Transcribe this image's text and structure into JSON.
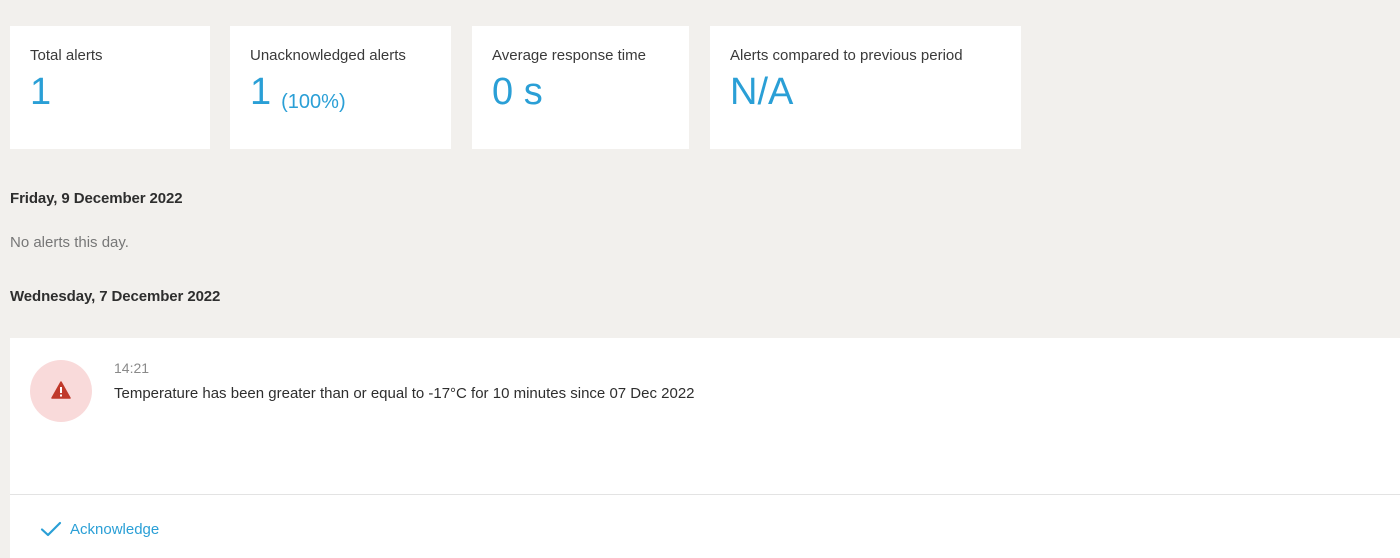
{
  "stats": {
    "total": {
      "label": "Total alerts",
      "value": "1"
    },
    "unacknowledged": {
      "label": "Unacknowledged alerts",
      "value": "1",
      "percent": "(100%)"
    },
    "response_time": {
      "label": "Average response time",
      "value": "0 s"
    },
    "compared": {
      "label": "Alerts compared to previous period",
      "value": "N/A"
    }
  },
  "days": [
    {
      "heading": "Friday, 9 December 2022",
      "empty_text": "No alerts this day."
    },
    {
      "heading": "Wednesday, 7 December 2022"
    }
  ],
  "alert": {
    "time": "14:21",
    "message": "Temperature has been greater than or equal to -17°C for 10 minutes since 07 Dec 2022",
    "icon": "warning-triangle-icon",
    "icon_color": "#c0392b",
    "icon_bg": "#f9dada"
  },
  "actions": {
    "acknowledge_label": "Acknowledge",
    "icon": "checkmark-icon"
  },
  "colors": {
    "accent": "#2a9fd6",
    "background": "#f2f0ed",
    "card": "#ffffff"
  }
}
